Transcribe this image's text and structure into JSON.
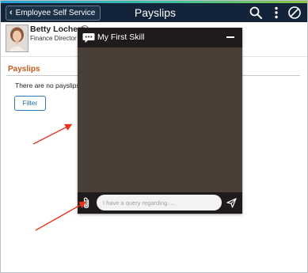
{
  "header": {
    "back_label": "Employee Self Service",
    "title": "Payslips",
    "icons": [
      "search-icon",
      "more-vertical-icon",
      "navbar-compass-icon"
    ]
  },
  "profile": {
    "name": "Betty Locherty",
    "job_title": "Finance Director"
  },
  "section": {
    "title": "Payslips",
    "empty_message": "There are no payslips",
    "filter_label": "Filter"
  },
  "chat": {
    "title": "My First Skill",
    "input_placeholder": "I have a query regarding.....",
    "icons": [
      "chat-bubble-icon",
      "minimize-icon",
      "paperclip-icon",
      "send-icon"
    ]
  },
  "colors": {
    "header_bg": "#13243a",
    "section_title": "#c05a1d",
    "filter_border": "#2a7bbf",
    "chat_bg": "#4a3f37",
    "chat_bar": "#1f1b1b",
    "annotation_arrow": "#e8341c"
  }
}
